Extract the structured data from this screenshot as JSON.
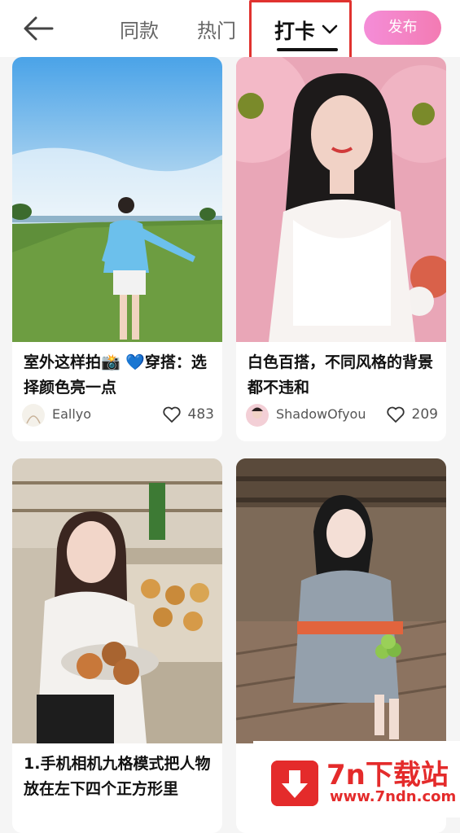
{
  "header": {
    "tabs": [
      "同款",
      "热门"
    ],
    "active_tab": "打卡",
    "publish_label": "发布"
  },
  "cards": [
    {
      "title": "室外这样拍📸 💙穿搭：选择颜色亮一点",
      "author": "Eallyo",
      "likes": "483"
    },
    {
      "title": "白色百搭，不同风格的背景都不违和",
      "author": "ShadowOfyou",
      "likes": "209"
    },
    {
      "title": "1.手机相机九格模式把人物放在左下四个正方形里",
      "author": "",
      "likes": ""
    },
    {
      "title": "",
      "author": "",
      "likes": ""
    }
  ],
  "watermark": {
    "brand": "7n下载站",
    "url": "www.7ndn.com"
  },
  "colors": {
    "accent": "#e0322f",
    "publish_gradient_start": "#f48dd8",
    "publish_gradient_end": "#f37bb3"
  }
}
